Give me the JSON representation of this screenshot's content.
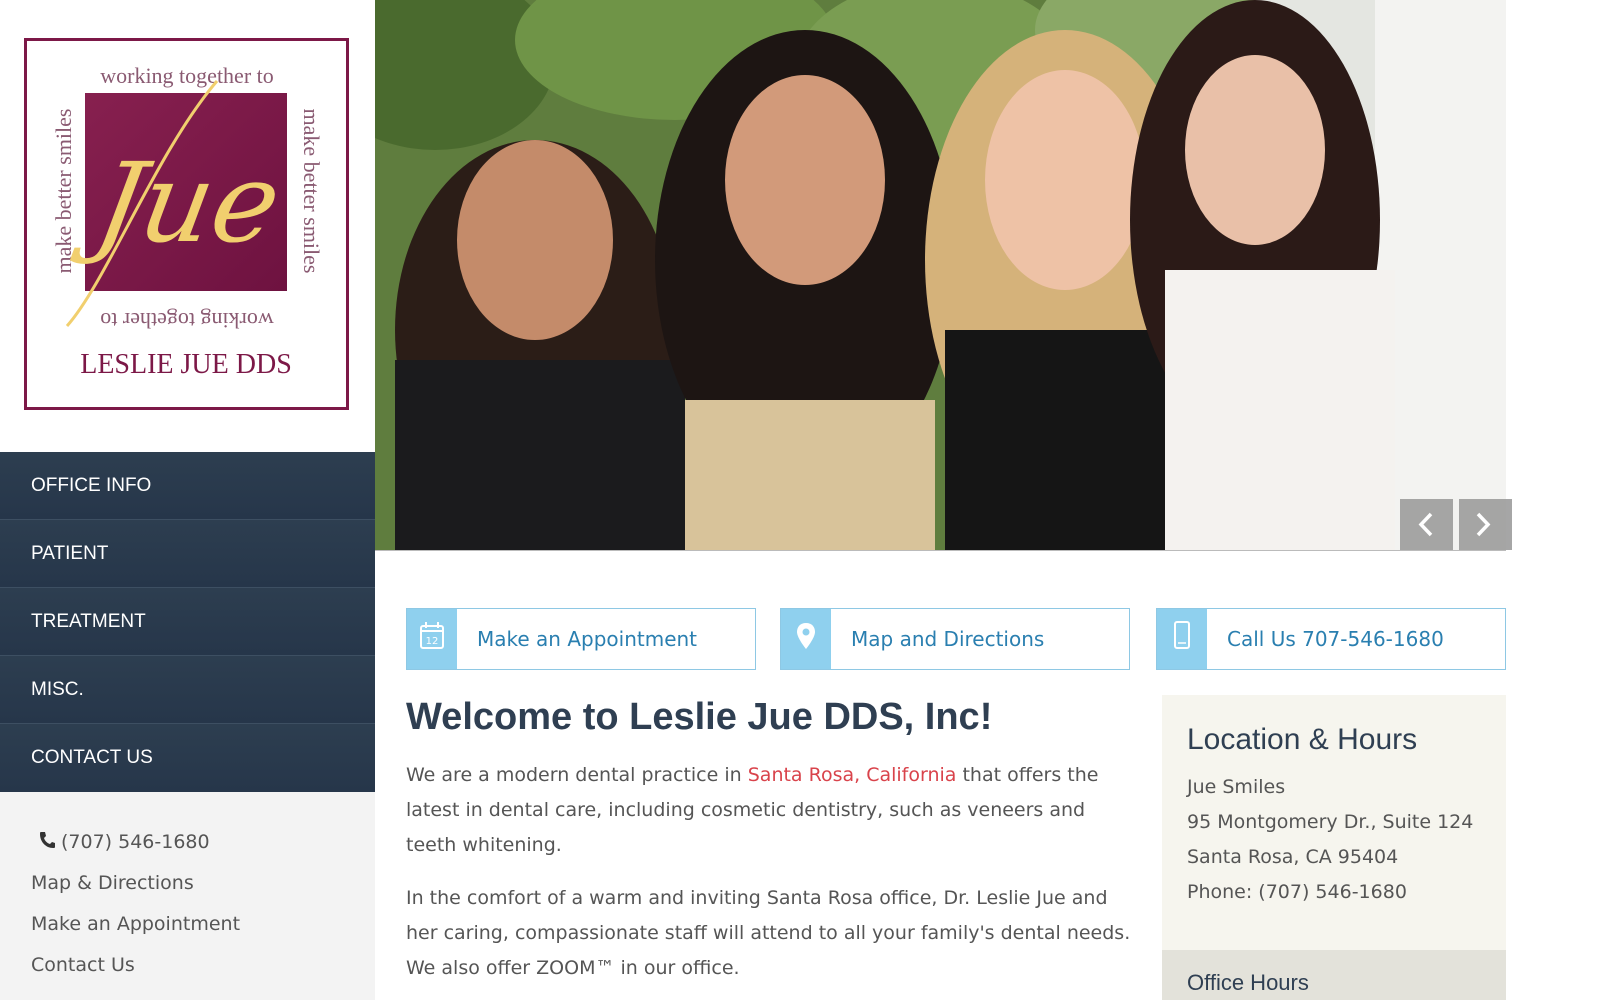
{
  "logo": {
    "arc_top": "working together to",
    "arc_right": "make better smiles",
    "arc_bottom": "working together to",
    "arc_left": "make better smiles",
    "script_mark": "Jue",
    "name": "LESLIE JUE DDS",
    "colors": {
      "burgundy": "#7c1847",
      "gold": "#f1cf6e"
    }
  },
  "nav": {
    "items": [
      {
        "label": "OFFICE INFO"
      },
      {
        "label": "PATIENT"
      },
      {
        "label": "TREATMENT"
      },
      {
        "label": "MISC."
      },
      {
        "label": "CONTACT US"
      }
    ]
  },
  "sidebar_links": {
    "phone": "(707) 546-1680",
    "map": "Map & Directions",
    "appointment": "Make an Appointment",
    "contact": "Contact Us"
  },
  "hero": {
    "prev_icon": "chevron-left-icon",
    "next_icon": "chevron-right-icon"
  },
  "cta": {
    "appointment": {
      "label": "Make an Appointment",
      "icon": "calendar-icon",
      "calendar_day": "12"
    },
    "map": {
      "label": "Map and Directions",
      "icon": "map-pin-icon"
    },
    "call": {
      "label": "Call Us 707-546-1680",
      "icon": "mobile-phone-icon"
    }
  },
  "main": {
    "title": "Welcome to Leslie Jue DDS, Inc!",
    "p1_before": "We are a modern dental practice in ",
    "p1_link": "Santa Rosa, California",
    "p1_after": " that offers the latest in dental care, including cosmetic dentistry, such as veneers and teeth whitening.",
    "p2": "In the comfort of a warm and inviting Santa Rosa office, Dr. Leslie Jue and her caring, compassionate staff will attend to all your family's dental needs. We also offer ZOOM™ in our office."
  },
  "location": {
    "title": "Location & Hours",
    "name": "Jue Smiles",
    "address": "95 Montgomery Dr., Suite 124",
    "city": "Santa Rosa, CA 95404",
    "phone": "Phone: (707) 546-1680",
    "hours_title": "Office Hours"
  },
  "colors": {
    "nav_bg": "#2a3a4b",
    "accent_blue": "#2a7fb0",
    "icon_blue": "#8fd0ee",
    "link_red": "#d9434b",
    "heading": "#2f3f52"
  }
}
